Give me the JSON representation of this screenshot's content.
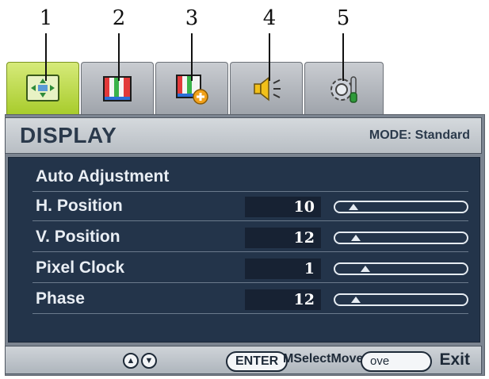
{
  "callouts": [
    "1",
    "2",
    "3",
    "4",
    "5"
  ],
  "tabs": [
    {
      "icon": "display-icon",
      "active": true
    },
    {
      "icon": "picture-icon",
      "active": false
    },
    {
      "icon": "picture-advanced-icon",
      "active": false
    },
    {
      "icon": "audio-icon",
      "active": false
    },
    {
      "icon": "system-icon",
      "active": false
    }
  ],
  "header": {
    "title": "DISPLAY",
    "mode": "MODE: Standard"
  },
  "menu": {
    "items": [
      {
        "label": "Auto Adjustment"
      },
      {
        "label": "H. Position",
        "value": "10",
        "level": 0.1
      },
      {
        "label": "V. Position",
        "value": "12",
        "level": 0.12
      },
      {
        "label": "Pixel Clock",
        "value": "1",
        "level": 0.2
      },
      {
        "label": "Phase",
        "value": "12",
        "level": 0.12
      }
    ]
  },
  "footer": {
    "enter_label": "ENTER",
    "overlap_text": "MSelectMove",
    "menu_label": "ove",
    "exit_label": "Exit"
  },
  "colors": {
    "active_tab": "#a8cc2c",
    "panel_bg": "#23344a",
    "frame": "#7c8591"
  }
}
